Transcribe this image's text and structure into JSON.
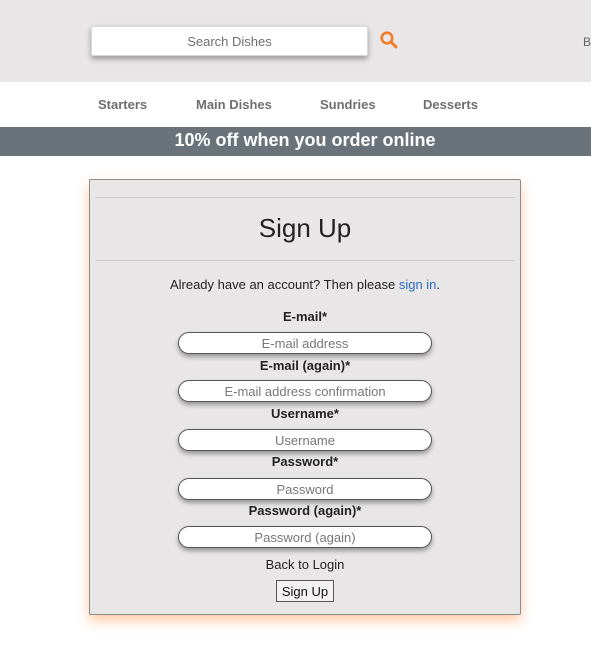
{
  "header": {
    "search": {
      "placeholder": "Search Dishes",
      "value": ""
    },
    "search_icon": "search-icon",
    "cut_text": "B"
  },
  "nav": {
    "items": [
      {
        "label": "Starters"
      },
      {
        "label": "Main Dishes"
      },
      {
        "label": "Sundries"
      },
      {
        "label": "Desserts"
      }
    ]
  },
  "promo": {
    "text": "10% off when you order online"
  },
  "signup": {
    "title": "Sign Up",
    "account_text": "Already have an account? Then please ",
    "signin_link": "sign in",
    "account_suffix": ".",
    "fields": [
      {
        "label": "E-mail*",
        "placeholder": "E-mail address",
        "value": ""
      },
      {
        "label": "E-mail (again)*",
        "placeholder": "E-mail address confirmation",
        "value": ""
      },
      {
        "label": "Username*",
        "placeholder": "Username",
        "value": ""
      },
      {
        "label": "Password*",
        "placeholder": "Password",
        "value": ""
      },
      {
        "label": "Password (again)*",
        "placeholder": "Password (again)",
        "value": ""
      }
    ],
    "back_to_login": "Back to Login",
    "submit_label": "Sign Up"
  },
  "colors": {
    "accent": "#f07c28",
    "link": "#2a6dc9",
    "promo_bg": "#6b737a",
    "panel_bg": "#e8e6e6"
  }
}
